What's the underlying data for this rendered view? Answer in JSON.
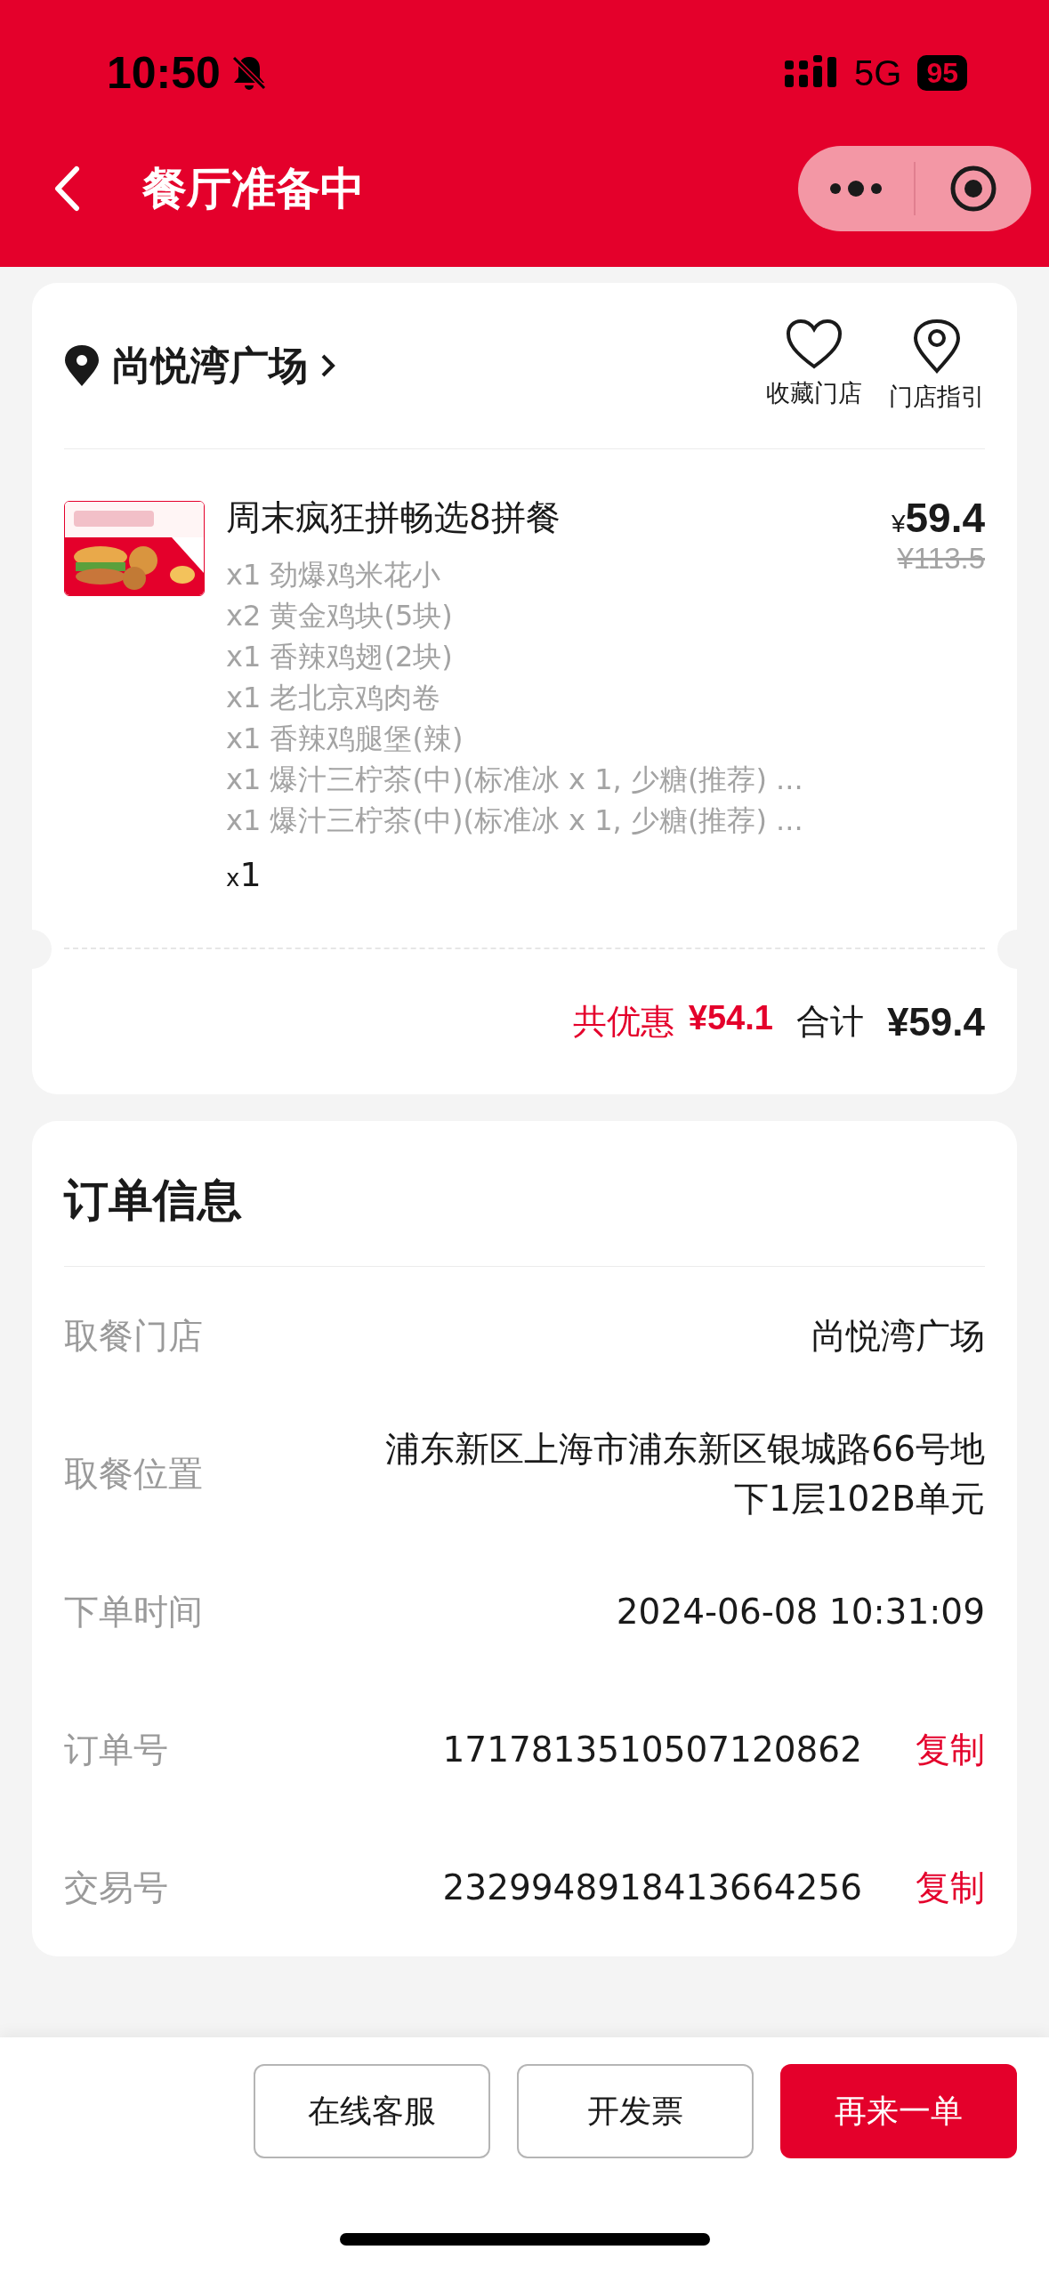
{
  "status_bar": {
    "time": "10:50",
    "network": "5G",
    "battery": "95"
  },
  "nav": {
    "title": "餐厅准备中"
  },
  "store": {
    "name": "尚悦湾广场",
    "actions": [
      {
        "kind": "favorite",
        "label": "收藏门店"
      },
      {
        "kind": "guide",
        "label": "门店指引"
      }
    ]
  },
  "product": {
    "name": "周末疯狂拼畅选8拼餐",
    "items": [
      "x1 劲爆鸡米花小",
      "x2 黄金鸡块(5块)",
      "x1 香辣鸡翅(2块)",
      "x1 老北京鸡肉卷",
      "x1 香辣鸡腿堡(辣)",
      "x1 爆汁三柠茶(中)(标准冰 x 1, 少糖(推荐) ...",
      "x1 爆汁三柠茶(中)(标准冰 x 1, 少糖(推荐) ..."
    ],
    "quantity_prefix": "x",
    "quantity": "1",
    "currency": "¥",
    "price": "59.4",
    "original_price": "¥113.5"
  },
  "summary": {
    "discount_label": "共优惠",
    "discount": "¥54.1",
    "total_label": "合计",
    "total": "¥59.4"
  },
  "order_info": {
    "title": "订单信息",
    "rows": [
      {
        "label": "取餐门店",
        "value": "尚悦湾广场"
      },
      {
        "label": "取餐位置",
        "value": "浦东新区上海市浦东新区银城路66号地下1层102B单元"
      },
      {
        "label": "下单时间",
        "value": "2024-06-08 10:31:09"
      },
      {
        "label": "订单号",
        "value": "1717813510507120862",
        "action": "复制"
      },
      {
        "label": "交易号",
        "value": "2329948918413664256",
        "action": "复制"
      }
    ]
  },
  "buttons": [
    {
      "label": "在线客服",
      "kind": "outline"
    },
    {
      "label": "开发票",
      "kind": "outline"
    },
    {
      "label": "再来一单",
      "kind": "primary"
    }
  ]
}
